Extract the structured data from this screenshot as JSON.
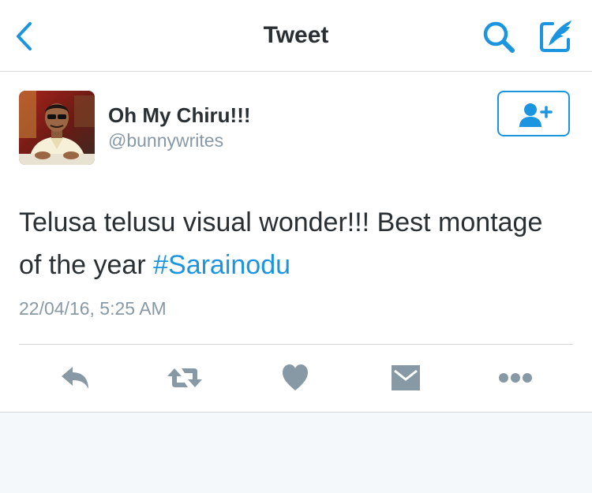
{
  "nav": {
    "title": "Tweet",
    "back_icon": "back-chevron-icon",
    "search_icon": "search-icon",
    "compose_icon": "compose-tweet-icon"
  },
  "tweet": {
    "author_name": "Oh My Chiru!!!",
    "author_handle": "@bunnywrites",
    "follow_icon": "follow-user-icon",
    "text_before_hashtag": "Telusa telusu visual wonder!!! Best montage of the year ",
    "hashtag": "#Sarainodu",
    "timestamp": "22/04/16, 5:25 AM"
  },
  "actions": [
    {
      "icon": "reply-icon"
    },
    {
      "icon": "retweet-icon"
    },
    {
      "icon": "like-heart-icon"
    },
    {
      "icon": "direct-message-icon"
    },
    {
      "icon": "more-options-icon"
    }
  ],
  "colors": {
    "accent": "#1b95e0",
    "text": "#292f33",
    "muted": "#8899a6",
    "action_icon": "#8899a6",
    "background": "#f5f8fa"
  }
}
